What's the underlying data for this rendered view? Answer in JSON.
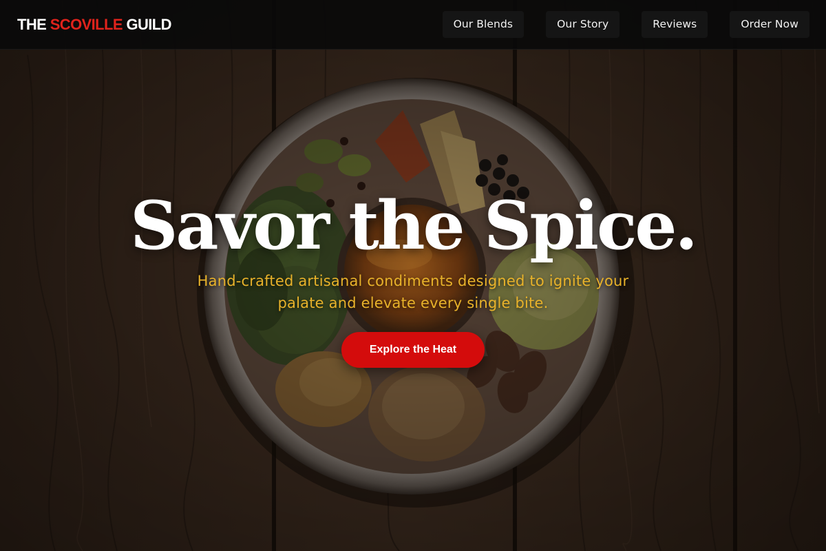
{
  "brand": {
    "part1": "THE ",
    "part2": "SCOVILLE",
    "part3": " GUILD",
    "accent_color": "#e0231c"
  },
  "nav": {
    "items": [
      {
        "label": "Our Blends"
      },
      {
        "label": "Our Story"
      },
      {
        "label": "Reviews"
      },
      {
        "label": "Order Now"
      }
    ]
  },
  "hero": {
    "title": "Savor the Spice.",
    "subtitle": "Hand-crafted artisanal condiments designed to ignite your palate and elevate every single bite.",
    "cta_label": "Explore the Heat",
    "cta_color": "#d40c0c",
    "subtitle_color": "#e8b22a",
    "background_image": "spice-plate-on-wood"
  }
}
